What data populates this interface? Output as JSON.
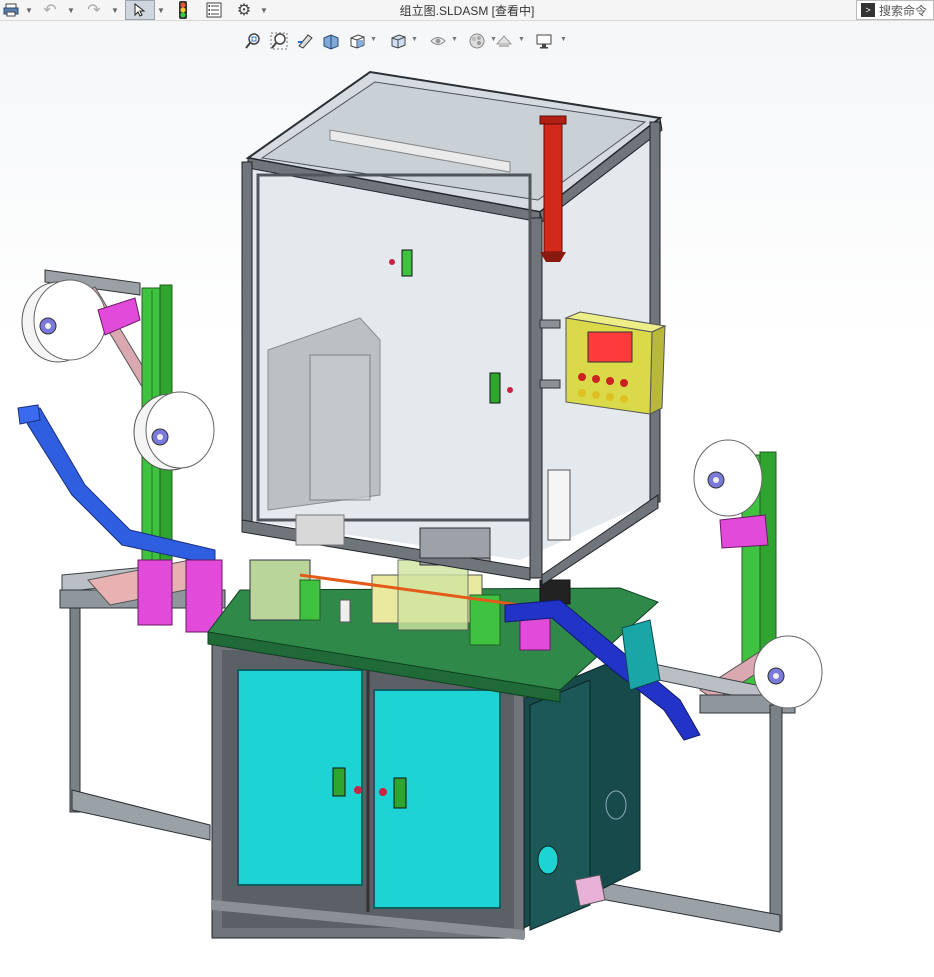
{
  "window": {
    "title": "组立图.SLDASM [查看中]",
    "search_placeholder": "搜索命令"
  },
  "toolbar": {
    "items": [
      "print-icon",
      "undo-icon",
      "redo-icon",
      "select-icon",
      "rebuild-icon",
      "file-properties-icon",
      "options-icon"
    ]
  },
  "headsup_toolbar": {
    "items": [
      "zoom-to-fit-icon",
      "zoom-to-area-icon",
      "previous-view-icon",
      "section-view-icon",
      "view-orientation-icon",
      "display-style-icon",
      "hide-show-items-icon",
      "edit-appearance-icon",
      "apply-scene-icon",
      "view-settings-icon"
    ]
  },
  "colors": {
    "frame": "#6f757b",
    "glass": "#dfe5ea",
    "cabinet_door": "#1ed3d3",
    "table_top": "#2f8a4a",
    "magenta_brackets": "#e24ad9",
    "green_extrusion": "#3fc23f",
    "blue_chute": "#2f4fd8",
    "red_cylinder": "#d12a1a",
    "control_box": "#d9d94a",
    "hmi_screen": "#ff3a3a"
  }
}
